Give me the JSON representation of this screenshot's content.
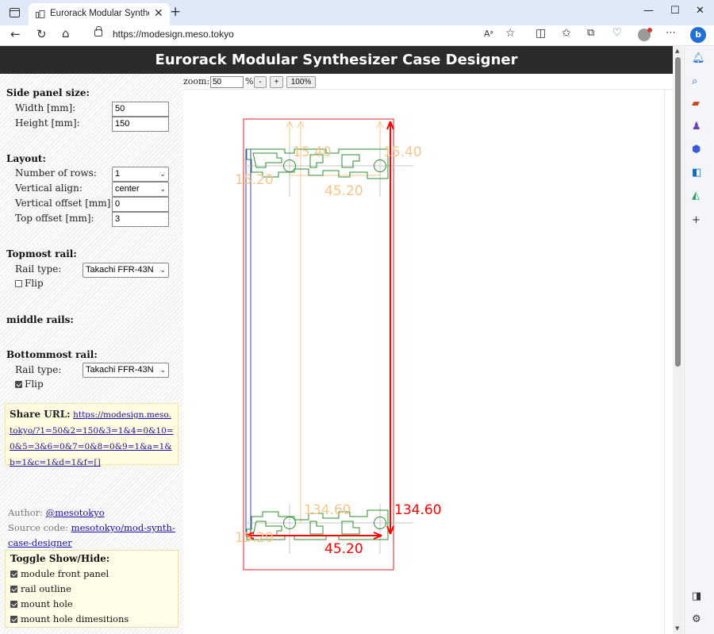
{
  "browser": {
    "tab_title": "Eurorack Modular Synthesizer Case Designer",
    "new_tab_label": "+",
    "url": "https://modesign.meso.tokyo",
    "read_aloud_label": "Aᵃ",
    "edge_logo_label": "b"
  },
  "page": {
    "title": "Eurorack Modular Synthesizer Case Designer"
  },
  "side_panel": {
    "heading": "Side panel size:",
    "width_label": "Width [mm]:",
    "width_value": "50",
    "height_label": "Height [mm]:",
    "height_value": "150"
  },
  "layout": {
    "heading": "Layout:",
    "rows_label": "Number of rows:",
    "rows_value": "1",
    "valign_label": "Vertical align:",
    "valign_value": "center",
    "voffset_label": "Vertical offset [mm]:",
    "voffset_value": "0",
    "toffset_label": "Top offset [mm]:",
    "toffset_value": "3"
  },
  "topmost_rail": {
    "heading": "Topmost rail:",
    "type_label": "Rail type:",
    "type_value": "Takachi FFR-43N",
    "flip_label": "Flip",
    "flip_checked": false
  },
  "middle_rails": {
    "heading": "middle rails:"
  },
  "bottommost_rail": {
    "heading": "Bottommost rail:",
    "type_label": "Rail type:",
    "type_value": "Takachi FFR-43N",
    "flip_label": "Flip",
    "flip_checked": true
  },
  "share": {
    "label": "Share URL:",
    "url": "https://modesign.meso.tokyo/?1=50&2=150&3=1&4=0&10=0&5=3&6=0&7=0&8=0&9=1&a=1&b=1&c=1&d=1&f=[]"
  },
  "credits": {
    "author_label": "Author:",
    "author_link": "@mesotokyo",
    "source_label": "Source code:",
    "source_link": "mesotokyo/mod-synth-case-designer"
  },
  "toggles": {
    "title": "Toggle Show/Hide:",
    "items": [
      {
        "label": "module front panel",
        "checked": true
      },
      {
        "label": "rail outline",
        "checked": true
      },
      {
        "label": "mount hole",
        "checked": true
      },
      {
        "label": "mount hole dimesitions",
        "checked": true
      }
    ]
  },
  "zoom": {
    "label": "zoom:",
    "value": "50",
    "unit": "%",
    "minus": "-",
    "plus": "+",
    "reset": "100%"
  },
  "drawing": {
    "top_dims": [
      "15.40",
      "15.40",
      "15.20",
      "45.20"
    ],
    "bottom_dims": [
      "134.60",
      "134.60",
      "15.20",
      "45.20"
    ],
    "colors": {
      "outline": "#e02020",
      "rail": "#2e8b2e",
      "panel": "#3a3ad0",
      "dim_light": "#f5c68a",
      "dim_strong": "#ff0000",
      "header_bg": "#2b2b2b"
    }
  }
}
